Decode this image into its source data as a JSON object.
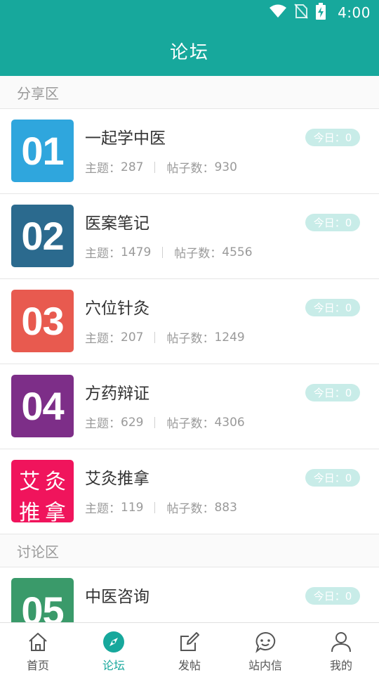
{
  "status_bar": {
    "time": "4:00"
  },
  "app_bar": {
    "title": "论坛"
  },
  "sections": [
    {
      "title": "分享区",
      "items": [
        {
          "icon_text": "01",
          "icon_color": "#2fa6dd",
          "title": "一起学中医",
          "topics_label": "主题：",
          "topics": "287",
          "posts_label": "帖子数：",
          "posts": "930",
          "today": "今日：0"
        },
        {
          "icon_text": "02",
          "icon_color": "#2b6a8e",
          "title": "医案笔记",
          "topics_label": "主题：",
          "topics": "1479",
          "posts_label": "帖子数：",
          "posts": "4556",
          "today": "今日：0"
        },
        {
          "icon_text": "03",
          "icon_color": "#e85a4f",
          "title": "穴位针灸",
          "topics_label": "主题：",
          "topics": "207",
          "posts_label": "帖子数：",
          "posts": "1249",
          "today": "今日：0"
        },
        {
          "icon_text": "04",
          "icon_color": "#7d2e88",
          "title": "方药辩证",
          "topics_label": "主题：",
          "topics": "629",
          "posts_label": "帖子数：",
          "posts": "4306",
          "today": "今日：0"
        },
        {
          "icon_chars": [
            "艾",
            "灸",
            "推",
            "拿"
          ],
          "icon_color": "#f0145c",
          "title": "艾灸推拿",
          "topics_label": "主题：",
          "topics": "119",
          "posts_label": "帖子数：",
          "posts": "883",
          "today": "今日：0"
        }
      ]
    },
    {
      "title": "讨论区",
      "items": [
        {
          "icon_text": "05",
          "icon_color": "#3a9a6a",
          "title": "中医咨询",
          "today": "今日：0"
        }
      ]
    }
  ],
  "bottom_nav": [
    {
      "label": "首页",
      "icon": "home-icon",
      "active": false
    },
    {
      "label": "论坛",
      "icon": "compass-icon",
      "active": true
    },
    {
      "label": "发帖",
      "icon": "edit-icon",
      "active": false
    },
    {
      "label": "站内信",
      "icon": "message-icon",
      "active": false
    },
    {
      "label": "我的",
      "icon": "user-icon",
      "active": false
    }
  ],
  "colors": {
    "primary": "#17a89c",
    "badge_bg": "#c8ece8"
  }
}
